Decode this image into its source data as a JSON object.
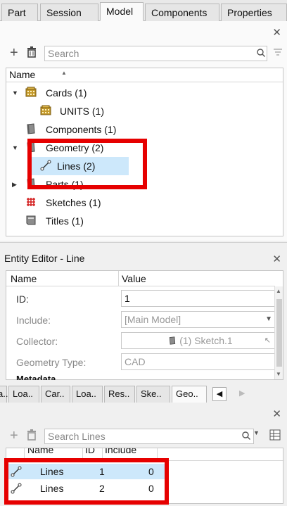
{
  "tabs": [
    "Part",
    "Session",
    "Model",
    "Components",
    "Properties"
  ],
  "active_tab": "Model",
  "model_search": {
    "placeholder": "Search"
  },
  "tree": {
    "header": "Name",
    "items": [
      {
        "label": "Cards",
        "count": "(1)",
        "icon": "cards-icon"
      },
      {
        "label": "UNITS",
        "count": "(1)",
        "icon": "units-icon"
      },
      {
        "label": "Components",
        "count": "(1)",
        "icon": "component-icon"
      },
      {
        "label": "Geometry",
        "count": "(2)",
        "icon": "geometry-icon"
      },
      {
        "label": "Lines",
        "count": "(2)",
        "icon": "line-icon"
      },
      {
        "label": "Parts",
        "count": "(1)",
        "icon": "part-icon"
      },
      {
        "label": "Sketches",
        "count": "(1)",
        "icon": "sketch-icon"
      },
      {
        "label": "Titles",
        "count": "(1)",
        "icon": "title-icon"
      }
    ]
  },
  "entity_editor": {
    "title": "Entity Editor - Line",
    "col_name": "Name",
    "col_value": "Value",
    "rows": [
      {
        "label": "ID:",
        "value": "1"
      },
      {
        "label": "Include:",
        "value": "[Main Model]"
      },
      {
        "label": "Collector:",
        "value": "(1) Sketch.1"
      },
      {
        "label": "Geometry Type:",
        "value": "CAD"
      }
    ],
    "section": "Metadata"
  },
  "bottom_tabs": [
    "a..",
    "Loa..",
    "Car..",
    "Loa..",
    "Res..",
    "Ske..",
    "Geo.."
  ],
  "active_bottom_tab": "Geo..",
  "lines_search": {
    "placeholder": "Search Lines"
  },
  "lines_grid": {
    "headers": [
      "",
      "Name",
      "ID",
      "Include"
    ],
    "rows": [
      {
        "name": "Lines",
        "id": "1",
        "include": "0"
      },
      {
        "name": "Lines",
        "id": "2",
        "include": "0"
      }
    ]
  },
  "colors": {
    "highlight": "#cde8fb",
    "annotation": "#e60000"
  }
}
